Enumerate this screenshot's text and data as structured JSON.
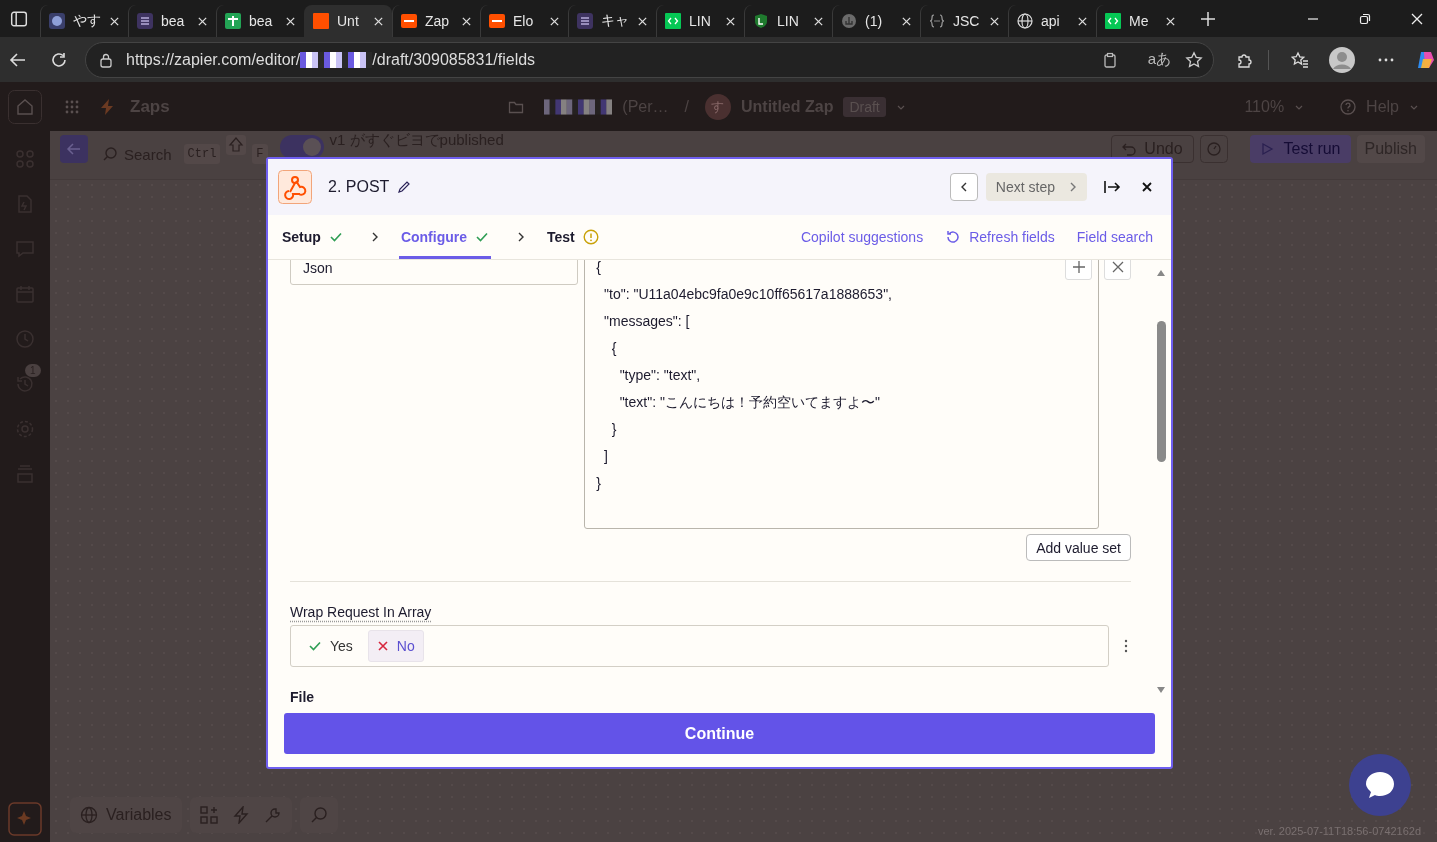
{
  "browser": {
    "tabs": [
      {
        "label": "やす",
        "kind": "chart",
        "selected": false
      },
      {
        "label": "bea",
        "kind": "list",
        "selected": false
      },
      {
        "label": "bea",
        "kind": "sheet",
        "selected": false
      },
      {
        "label": "Unt",
        "kind": "square",
        "selected": true
      },
      {
        "label": "Zap",
        "kind": "zapier",
        "selected": false
      },
      {
        "label": "Elo",
        "kind": "zapier",
        "selected": false
      },
      {
        "label": "キャ",
        "kind": "list",
        "selected": false
      },
      {
        "label": "LIN",
        "kind": "code",
        "selected": false
      },
      {
        "label": "LIN",
        "kind": "shield",
        "selected": false
      },
      {
        "label": "(1)",
        "kind": "circle",
        "selected": false
      },
      {
        "label": "JSC",
        "kind": "braces",
        "selected": false
      },
      {
        "label": "api",
        "kind": "globe",
        "selected": false
      },
      {
        "label": "Me",
        "kind": "code",
        "selected": false
      }
    ],
    "url_prefix": "https://zapier.com/editor/",
    "url_suffix": "/draft/309085831/fields",
    "translate_glyph": "aあ"
  },
  "app_bar": {
    "section": "Zaps",
    "folder": "(Per…",
    "separator": "/",
    "avatar": "す",
    "zap_name": "Untitled Zap",
    "status": "Draft",
    "zoom": "110%",
    "help": "Help"
  },
  "toolbar": {
    "search": "Search",
    "shortcut_keys": [
      "Ctrl",
      "F"
    ],
    "toggle_on": true,
    "version": "v1 がすぐビヨでpublished",
    "undo": "Undo",
    "test_run": "Test run",
    "publish": "Publish"
  },
  "sidebar": {
    "badge": "1"
  },
  "modal": {
    "step_title": "2. POST",
    "next_step": "Next step",
    "steps": [
      {
        "label": "Setup",
        "complete": true,
        "selected": false
      },
      {
        "label": "Configure",
        "complete": true,
        "selected": true
      },
      {
        "label": "Test",
        "complete": false,
        "selected": false
      }
    ],
    "actions": [
      {
        "label": "Copilot suggestions",
        "kind": "plain"
      },
      {
        "label": "Refresh fields",
        "kind": "refresh"
      },
      {
        "label": "Field search",
        "kind": "plain"
      }
    ],
    "data_key": "Json",
    "data_value": [
      "{",
      "  \"to\": \"U11a04ebc9fa0e9c10ff65617a1888653\",",
      "  \"messages\": [",
      "    {",
      "      \"type\": \"text\",",
      "      \"text\": \"こんにちは！予約空いてますよ〜\"",
      "    }",
      "  ]",
      "}"
    ],
    "add_value_set": "Add value set",
    "wrap": {
      "label": "Wrap Request In Array",
      "options": [
        {
          "label": "Yes",
          "kind": "yes",
          "selected": false
        },
        {
          "label": "No",
          "kind": "no",
          "selected": true
        }
      ]
    },
    "next_field": "File",
    "continue": "Continue"
  },
  "bottom_toolbar": {
    "variables": "Variables"
  },
  "version": "ver. 2025-07-11T18:56-0742162d"
}
